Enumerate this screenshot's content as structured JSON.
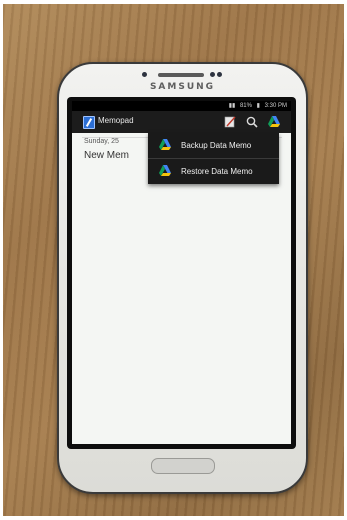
{
  "device": {
    "brand": "SAMSUNG"
  },
  "status_bar": {
    "signal": "▮▮",
    "battery": "81%",
    "time": "3:30 PM"
  },
  "action_bar": {
    "title": "Memopad",
    "icons": [
      "new-memo-icon",
      "search-icon",
      "google-drive-icon"
    ]
  },
  "memo": {
    "date": "Sunday, 25",
    "title": "New Mem"
  },
  "overflow_menu": {
    "items": [
      {
        "label": "Backup Data Memo",
        "icon": "google-drive-icon"
      },
      {
        "label": "Restore Data Memo",
        "icon": "google-drive-icon"
      }
    ]
  },
  "colors": {
    "drive_yellow": "#f4c20d",
    "drive_green": "#0f9d58",
    "drive_blue": "#4285f4"
  }
}
